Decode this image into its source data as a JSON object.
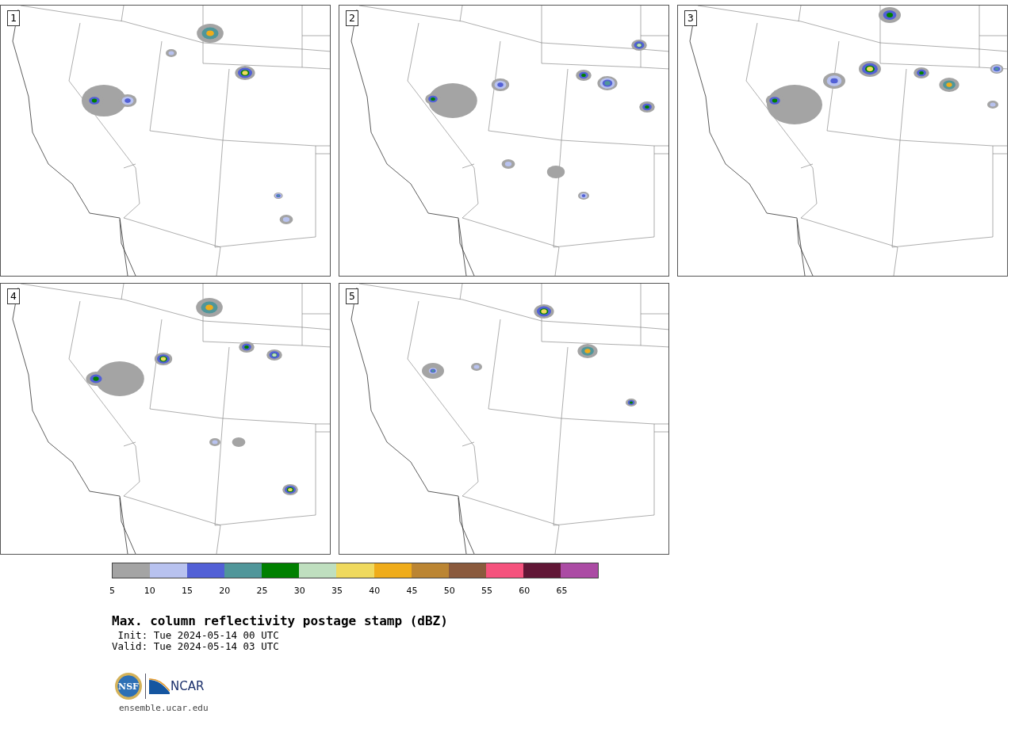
{
  "panels": [
    {
      "label": "1"
    },
    {
      "label": "2"
    },
    {
      "label": "3"
    },
    {
      "label": "4"
    },
    {
      "label": "5"
    }
  ],
  "colorbar": {
    "segments": [
      {
        "color": "#a4a4a4"
      },
      {
        "color": "#b8c2ef"
      },
      {
        "color": "#5260d6"
      },
      {
        "color": "#50969a"
      },
      {
        "color": "#008000"
      },
      {
        "color": "#bfdfbf"
      },
      {
        "color": "#efd95e"
      },
      {
        "color": "#efac1a"
      },
      {
        "color": "#bb8533"
      },
      {
        "color": "#8a5a3d"
      },
      {
        "color": "#f5527d"
      },
      {
        "color": "#611736"
      },
      {
        "color": "#ab4ba4"
      }
    ],
    "ticks": [
      "5",
      "10",
      "15",
      "20",
      "25",
      "30",
      "35",
      "40",
      "45",
      "50",
      "55",
      "60",
      "65"
    ]
  },
  "title": "Max. column reflectivity postage stamp (dBZ)",
  "init": " Init: Tue 2024-05-14 00 UTC",
  "valid": "Valid: Tue 2024-05-14 03 UTC",
  "logo": {
    "nsf_text": "NSF",
    "ncar_text": "NCAR"
  },
  "url": "ensemble.ucar.edu"
}
